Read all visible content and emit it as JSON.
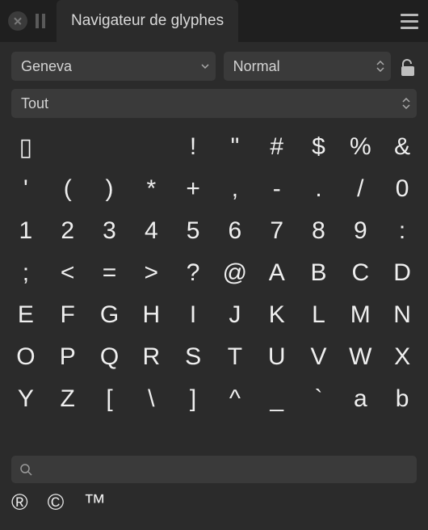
{
  "header": {
    "title": "Navigateur de glyphes"
  },
  "font_select": {
    "value": "Geneva"
  },
  "style_select": {
    "value": "Normal"
  },
  "subset_select": {
    "value": "Tout"
  },
  "search": {
    "value": "",
    "placeholder": ""
  },
  "glyphs": [
    "▯",
    "",
    "",
    "",
    "!",
    "\"",
    "#",
    "$",
    "%",
    "&",
    "'",
    "(",
    ")",
    "*",
    "+",
    ",",
    "-",
    ".",
    "/",
    "0",
    "1",
    "2",
    "3",
    "4",
    "5",
    "6",
    "7",
    "8",
    "9",
    ":",
    ";",
    "<",
    "=",
    ">",
    "?",
    "@",
    "A",
    "B",
    "C",
    "D",
    "E",
    "F",
    "G",
    "H",
    "I",
    "J",
    "K",
    "L",
    "M",
    "N",
    "O",
    "P",
    "Q",
    "R",
    "S",
    "T",
    "U",
    "V",
    "W",
    "X",
    "Y",
    "Z",
    "[",
    "\\",
    "]",
    "^",
    "_",
    "`",
    "a",
    "b"
  ],
  "ip_glyphs": [
    "®",
    "©",
    "™"
  ]
}
